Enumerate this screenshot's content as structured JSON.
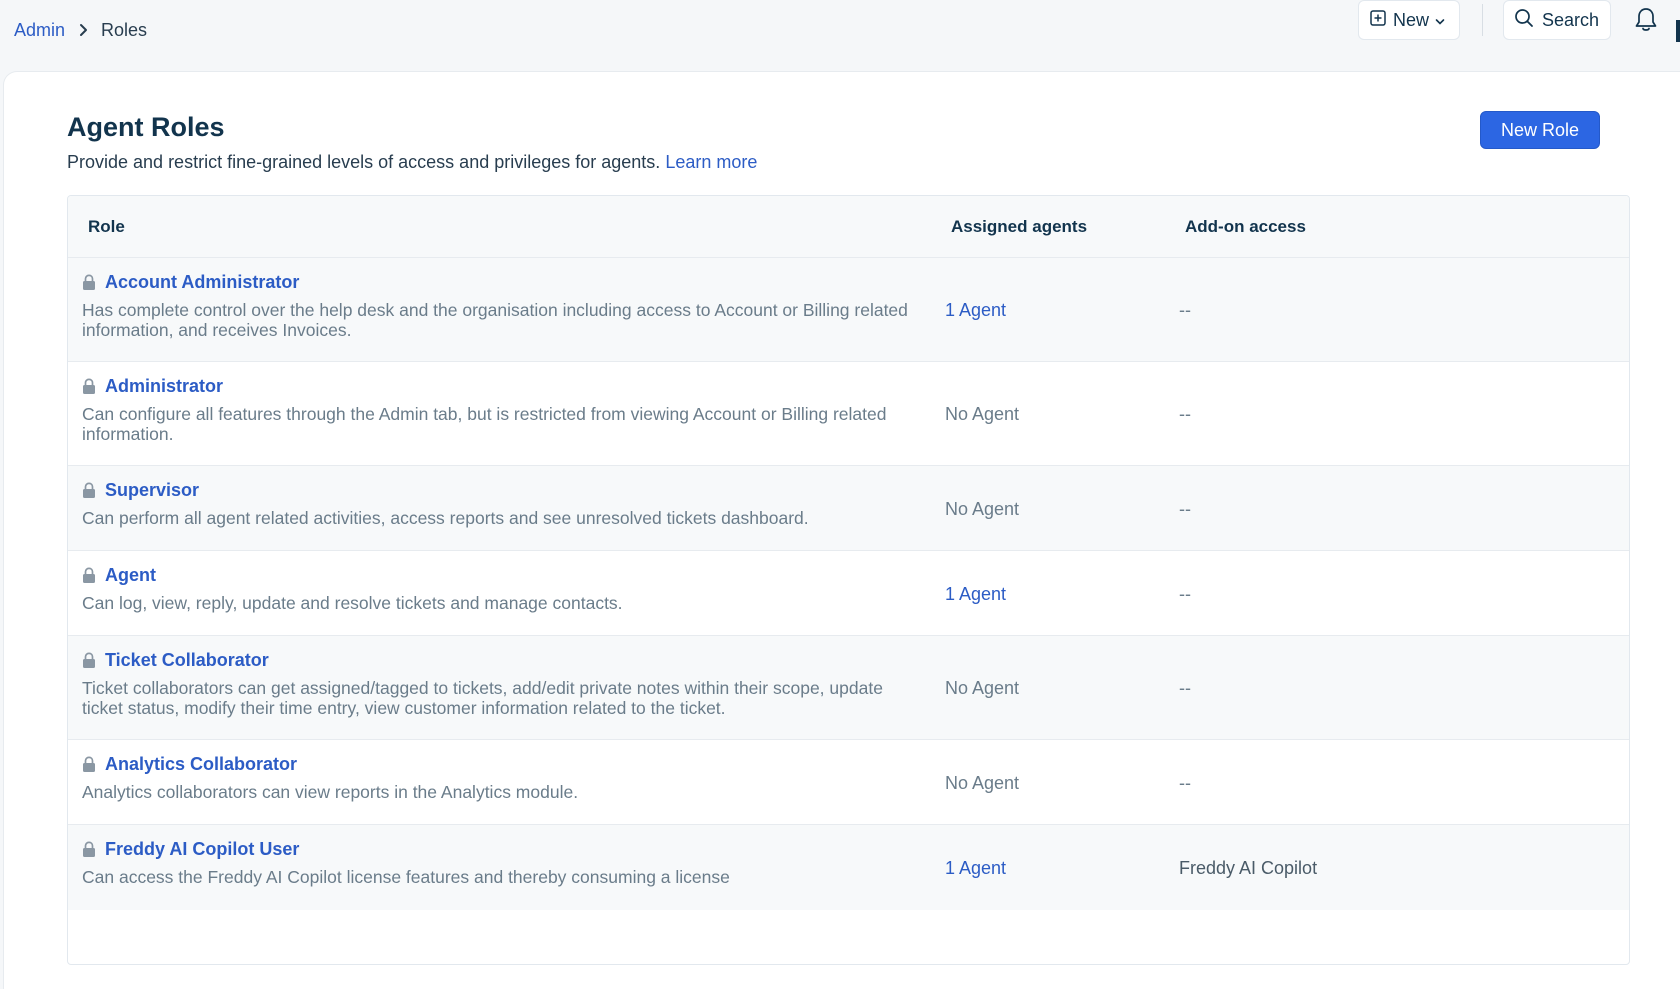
{
  "breadcrumb": {
    "parent": "Admin",
    "current": "Roles"
  },
  "topbar": {
    "new_label": "New",
    "search_label": "Search"
  },
  "page": {
    "title": "Agent Roles",
    "description": "Provide and restrict fine-grained levels of access and privileges for agents.",
    "learn_more": "Learn more",
    "new_role_label": "New Role"
  },
  "table": {
    "headers": {
      "role": "Role",
      "agents": "Assigned agents",
      "addon": "Add-on access"
    },
    "rows": [
      {
        "name": "Account Administrator",
        "description": "Has complete control over the help desk and the organisation including access to Account or Billing related information, and receives Invoices.",
        "agents": "1 Agent",
        "addon": "--"
      },
      {
        "name": "Administrator",
        "description": "Can configure all features through the Admin tab, but is restricted from viewing Account or Billing related information.",
        "agents": "No Agent",
        "addon": "--"
      },
      {
        "name": "Supervisor",
        "description": "Can perform all agent related activities, access reports and see unresolved tickets dashboard.",
        "agents": "No Agent",
        "addon": "--"
      },
      {
        "name": "Agent",
        "description": "Can log, view, reply, update and resolve tickets and manage contacts.",
        "agents": "1 Agent",
        "addon": "--"
      },
      {
        "name": "Ticket Collaborator",
        "description": "Ticket collaborators can get assigned/tagged to tickets, add/edit private notes within their scope, update ticket status, modify their time entry, view customer information related to the ticket.",
        "agents": "No Agent",
        "addon": "--"
      },
      {
        "name": "Analytics Collaborator",
        "description": "Analytics collaborators can view reports in the Analytics module.",
        "agents": "No Agent",
        "addon": "--"
      },
      {
        "name": "Freddy AI Copilot User",
        "description": "Can access the Freddy AI Copilot license features and thereby consuming a license",
        "agents": "1 Agent",
        "addon": "Freddy AI Copilot"
      }
    ]
  },
  "colors": {
    "link": "#2c5cc5",
    "primary_button": "#2c66e3",
    "muted_text": "#6a7c8a"
  },
  "icons": [
    "chevron-right-icon",
    "plus-square-icon",
    "chevron-down-icon",
    "search-icon",
    "bell-icon",
    "lock-icon"
  ]
}
